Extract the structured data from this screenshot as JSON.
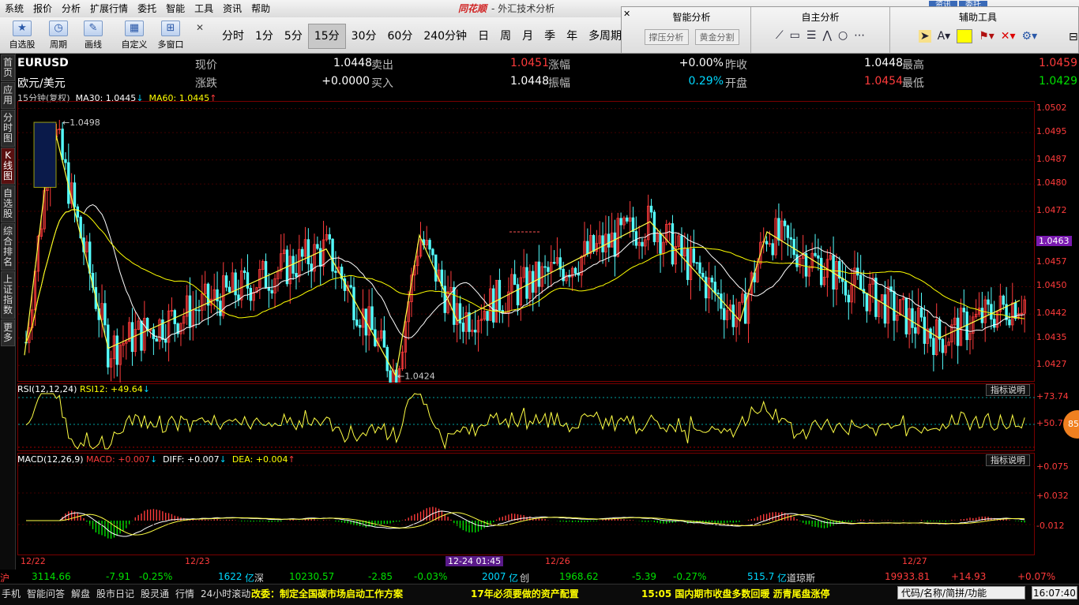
{
  "menu": [
    "系统",
    "报价",
    "分析",
    "扩展行情",
    "委托",
    "智能",
    "工具",
    "资讯",
    "帮助"
  ],
  "app_title": {
    "brand": "同花顺",
    "sep": "-",
    "module": "外汇技术分析"
  },
  "top_tabs": [
    "资讯",
    "委托"
  ],
  "toolbar": {
    "btns": [
      {
        "label": "自选股",
        "icon": "star-icon"
      },
      {
        "label": "周期",
        "icon": "clock-icon"
      },
      {
        "label": "画线",
        "icon": "pencil-icon"
      },
      {
        "label": "自定义",
        "icon": "grid-icon"
      },
      {
        "label": "多窗口",
        "icon": "windows-icon"
      }
    ],
    "periods": [
      "分时",
      "1分",
      "5分",
      "15分",
      "30分",
      "60分",
      "240分钟",
      "日",
      "周",
      "月",
      "季",
      "年",
      "多周期"
    ],
    "active_period": "15分"
  },
  "right_panel": {
    "smart_title": "智能分析",
    "smart_btn1": "撑压分析",
    "smart_btn2": "黄金分割",
    "self_title": "自主分析",
    "aux_title": "辅助工具"
  },
  "left_nav": [
    "首页",
    "应用",
    "分时图",
    "K线图",
    "自选股",
    "综合排名",
    "上证指数",
    "更多"
  ],
  "quote": {
    "symbol": "EURUSD",
    "name": "欧元/美元",
    "now_label": "现价",
    "now": "1.0448",
    "chg_label": "涨跌",
    "chg": "+0.0000",
    "sell_label": "卖出",
    "sell": "1.0451",
    "buy_label": "买入",
    "buy": "1.0448",
    "pct_label": "涨幅",
    "pct": "+0.00%",
    "amp_label": "振幅",
    "amp": "0.29%",
    "prev_label": "昨收",
    "prev": "1.0448",
    "open_label": "开盘",
    "open": "1.0454",
    "high_label": "最高",
    "high": "1.0459",
    "low_label": "最低",
    "low": "1.0429"
  },
  "ma_line": {
    "period": "15分钟(复权)",
    "ma30": "MA30: 1.0445",
    "ma60": "MA60: 1.0445"
  },
  "rsi": {
    "label": "RSI(12,12,24)",
    "value": "RSI12: +49.64",
    "axis": [
      "+73.74",
      "+50.77"
    ],
    "explain": "指标说明"
  },
  "macd": {
    "label": "MACD(12,26,9)",
    "macd": "MACD: +0.007",
    "diff": "DIFF: +0.007",
    "dea": "DEA: +0.004",
    "axis": [
      "+0.075",
      "+0.032",
      "-0.012"
    ],
    "explain": "指标说明"
  },
  "orange_badge": "85",
  "dates": [
    "12/22",
    "12/23",
    "12-24 01:45",
    "12/26",
    "12/27"
  ],
  "ticker": [
    {
      "t": "沪",
      "c": "#ff3b3b"
    },
    {
      "t": "3114.66",
      "c": "#00e000"
    },
    {
      "t": "-7.91",
      "c": "#00e000"
    },
    {
      "t": "-0.25%",
      "c": "#00e000"
    },
    {
      "t": "1622",
      "c": "#00d8ff"
    },
    {
      "t": "亿",
      "c": "#00d8ff"
    },
    {
      "t": "深",
      "c": "#ddd"
    },
    {
      "t": "10230.57",
      "c": "#00e000"
    },
    {
      "t": "-2.85",
      "c": "#00e000"
    },
    {
      "t": "-0.03%",
      "c": "#00e000"
    },
    {
      "t": "2007",
      "c": "#00d8ff"
    },
    {
      "t": "亿",
      "c": "#00d8ff"
    },
    {
      "t": "创",
      "c": "#ddd"
    },
    {
      "t": "1968.62",
      "c": "#00e000"
    },
    {
      "t": "-5.39",
      "c": "#00e000"
    },
    {
      "t": "-0.27%",
      "c": "#00e000"
    },
    {
      "t": "515.7",
      "c": "#00d8ff"
    },
    {
      "t": "亿",
      "c": "#00d8ff"
    },
    {
      "t": "道琼斯",
      "c": "#ddd"
    },
    {
      "t": "19933.81",
      "c": "#ff3b3b"
    },
    {
      "t": "+14.93",
      "c": "#ff3b3b"
    },
    {
      "t": "+0.07%",
      "c": "#ff3b3b"
    }
  ],
  "status": {
    "items": [
      "手机",
      "智能问答",
      "解盘",
      "股市日记",
      "股灵通",
      "行情",
      "24小时滚动"
    ],
    "news1": "改委：制定全国碳市场启动工作方案",
    "news2": "17年必须要做的资产配置",
    "news3": "15:05 国内期市收盘多数回暖 沥青尾盘涨停",
    "search": "代码/名称/简拼/功能",
    "clock": "16:07:40"
  },
  "chart_data": {
    "type": "candlestick",
    "symbol": "EURUSD",
    "period": "15分钟",
    "y_axis_ticks": [
      1.0502,
      1.0495,
      1.0487,
      1.048,
      1.0472,
      1.0463,
      1.0457,
      1.045,
      1.0442,
      1.0435,
      1.0427
    ],
    "ylim": [
      1.0422,
      1.0504
    ],
    "current_price": 1.0463,
    "marked_high": 1.0498,
    "marked_low": 1.0424,
    "zigzag": [
      1.043,
      1.0498,
      1.0432,
      1.0461,
      1.0424,
      1.0465,
      1.044,
      1.0469,
      1.044,
      1.0466,
      1.0435,
      1.0446
    ],
    "ma30_last": 1.0445,
    "ma60_last": 1.0445,
    "x_labels": [
      "12/22",
      "12/23",
      "12-24 01:45",
      "12/26",
      "12/27"
    ]
  }
}
